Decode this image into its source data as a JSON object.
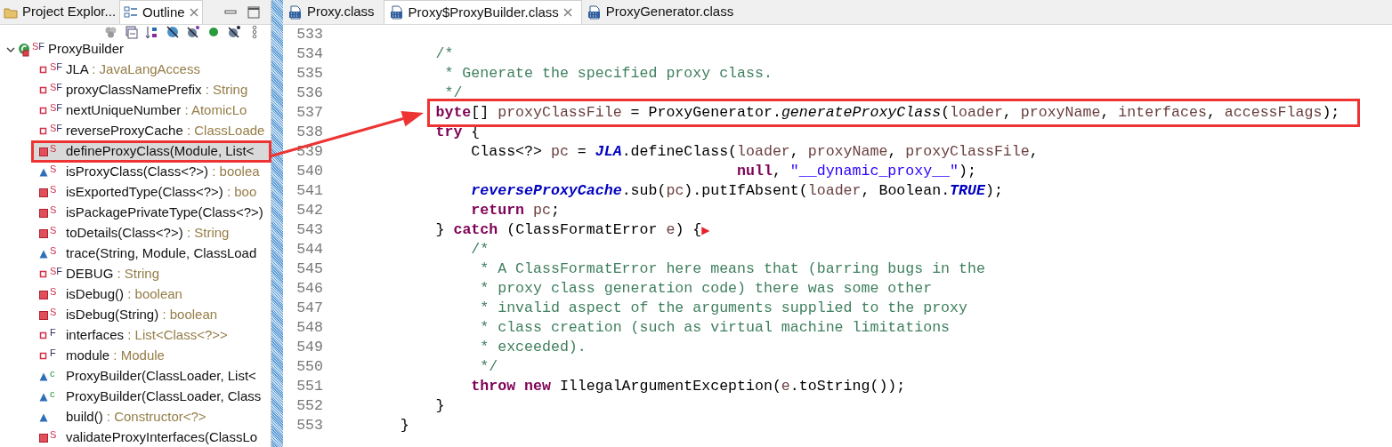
{
  "left_panel": {
    "tabs": [
      {
        "label": "Project Explor...",
        "selected": false,
        "closable": false
      },
      {
        "label": "Outline",
        "selected": true,
        "closable": true
      }
    ],
    "outline": {
      "root": {
        "name": "ProxyBuilder",
        "expanded": true,
        "modifiers": [
          {
            "kind": "static",
            "text": "S"
          },
          {
            "kind": "final",
            "text": "F"
          }
        ]
      },
      "items": [
        {
          "kind": "private-field",
          "modifiers": [
            {
              "kind": "static",
              "text": "S"
            },
            {
              "kind": "final",
              "text": "F"
            }
          ],
          "name": "JLA",
          "type": " : JavaLangAccess",
          "boxed": false
        },
        {
          "kind": "private-field",
          "modifiers": [
            {
              "kind": "static",
              "text": "S"
            },
            {
              "kind": "final",
              "text": "F"
            }
          ],
          "name": "proxyClassNamePrefix",
          "type": " : String",
          "boxed": false
        },
        {
          "kind": "private-field",
          "modifiers": [
            {
              "kind": "static",
              "text": "S"
            },
            {
              "kind": "final",
              "text": "F"
            }
          ],
          "name": "nextUniqueNumber",
          "type": " : AtomicLo",
          "boxed": false
        },
        {
          "kind": "private-field",
          "modifiers": [
            {
              "kind": "static",
              "text": "S"
            },
            {
              "kind": "final",
              "text": "F"
            }
          ],
          "name": "reverseProxyCache",
          "type": " : ClassLoade",
          "boxed": false
        },
        {
          "kind": "private-method",
          "modifiers": [
            {
              "kind": "static",
              "text": "S"
            }
          ],
          "name": "defineProxyClass(Module, List<",
          "boxed": true
        },
        {
          "kind": "package-method",
          "modifiers": [
            {
              "kind": "static",
              "text": "S"
            }
          ],
          "name": "isProxyClass(Class<?>)",
          "type": " : boolea",
          "boxed": false
        },
        {
          "kind": "private-method",
          "modifiers": [
            {
              "kind": "static",
              "text": "S"
            }
          ],
          "name": "isExportedType(Class<?>)",
          "type": " : boo",
          "boxed": false
        },
        {
          "kind": "private-method",
          "modifiers": [
            {
              "kind": "static",
              "text": "S"
            }
          ],
          "name": "isPackagePrivateType(Class<?>)",
          "boxed": false
        },
        {
          "kind": "private-method",
          "modifiers": [
            {
              "kind": "static",
              "text": "S"
            }
          ],
          "name": "toDetails(Class<?>)",
          "type": " : String",
          "boxed": false
        },
        {
          "kind": "package-method",
          "modifiers": [
            {
              "kind": "static",
              "text": "S"
            }
          ],
          "name": "trace(String, Module, ClassLoad",
          "boxed": false
        },
        {
          "kind": "private-field",
          "modifiers": [
            {
              "kind": "static",
              "text": "S"
            },
            {
              "kind": "final",
              "text": "F"
            }
          ],
          "name": "DEBUG",
          "type": " : String",
          "boxed": false
        },
        {
          "kind": "private-method",
          "modifiers": [
            {
              "kind": "static",
              "text": "S"
            }
          ],
          "name": "isDebug()",
          "type": " : boolean",
          "boxed": false
        },
        {
          "kind": "private-method",
          "modifiers": [
            {
              "kind": "static",
              "text": "S"
            }
          ],
          "name": "isDebug(String)",
          "type": " : boolean",
          "boxed": false
        },
        {
          "kind": "private-field",
          "modifiers": [
            {
              "kind": "final",
              "text": "F"
            }
          ],
          "name": "interfaces",
          "type": " : List<Class<?>>",
          "boxed": false
        },
        {
          "kind": "private-field",
          "modifiers": [
            {
              "kind": "final",
              "text": "F"
            }
          ],
          "name": "module",
          "type": " : Module",
          "boxed": false
        },
        {
          "kind": "package-method",
          "modifiers": [
            {
              "kind": "constructor",
              "text": "c"
            }
          ],
          "name": "ProxyBuilder(ClassLoader, List<",
          "boxed": false
        },
        {
          "kind": "package-method",
          "modifiers": [
            {
              "kind": "constructor",
              "text": "c"
            }
          ],
          "name": "ProxyBuilder(ClassLoader, Class",
          "boxed": false
        },
        {
          "kind": "package-method",
          "name": "build()",
          "type": " : Constructor<?>",
          "boxed": false
        },
        {
          "kind": "private-method",
          "modifiers": [
            {
              "kind": "static",
              "text": "S"
            }
          ],
          "name": "validateProxyInterfaces(ClassLo",
          "boxed": false
        }
      ]
    }
  },
  "editor": {
    "tabs": [
      {
        "label": "Proxy.class",
        "selected": false,
        "closable": false
      },
      {
        "label": "Proxy$ProxyBuilder.class",
        "selected": true,
        "closable": true
      },
      {
        "label": "ProxyGenerator.class",
        "selected": false,
        "closable": false
      }
    ],
    "lines": [
      {
        "number": "533",
        "boxed": false
      },
      {
        "number": "534",
        "boxed": false,
        "tokens": [
          {
            "kind": "comment",
            "text": "            /*"
          }
        ]
      },
      {
        "number": "535",
        "boxed": false,
        "tokens": [
          {
            "kind": "comment",
            "text": "             * Generate the specified proxy class."
          }
        ]
      },
      {
        "number": "536",
        "boxed": false,
        "tokens": [
          {
            "kind": "comment",
            "text": "             */"
          }
        ]
      },
      {
        "number": "537",
        "boxed": true,
        "tokens": [
          {
            "kind": "keyword",
            "text": "            byte"
          },
          {
            "kind": "plain",
            "text": "[] "
          },
          {
            "kind": "variable",
            "text": "proxyClassFile"
          },
          {
            "kind": "plain",
            "text": " = ProxyGenerator."
          },
          {
            "kind": "static_method",
            "text": "generateProxyClass"
          },
          {
            "kind": "plain",
            "text": "("
          },
          {
            "kind": "variable",
            "text": "loader"
          },
          {
            "kind": "plain",
            "text": ", "
          },
          {
            "kind": "variable",
            "text": "proxyName"
          },
          {
            "kind": "plain",
            "text": ", "
          },
          {
            "kind": "variable",
            "text": "interfaces"
          },
          {
            "kind": "plain",
            "text": ", "
          },
          {
            "kind": "variable",
            "text": "accessFlags"
          },
          {
            "kind": "plain",
            "text": ");"
          }
        ]
      },
      {
        "number": "538",
        "boxed": false,
        "tokens": [
          {
            "kind": "keyword",
            "text": "            try"
          },
          {
            "kind": "plain",
            "text": " {"
          }
        ]
      },
      {
        "number": "539",
        "boxed": false,
        "tokens": [
          {
            "kind": "plain",
            "text": "                Class<?> "
          },
          {
            "kind": "variable",
            "text": "pc"
          },
          {
            "kind": "plain",
            "text": " = "
          },
          {
            "kind": "static_field",
            "text": "JLA"
          },
          {
            "kind": "plain",
            "text": ".defineClass("
          },
          {
            "kind": "variable",
            "text": "loader"
          },
          {
            "kind": "plain",
            "text": ", "
          },
          {
            "kind": "variable",
            "text": "proxyName"
          },
          {
            "kind": "plain",
            "text": ", "
          },
          {
            "kind": "variable",
            "text": "proxyClassFile"
          },
          {
            "kind": "plain",
            "text": ","
          }
        ]
      },
      {
        "number": "540",
        "boxed": false,
        "tokens": [
          {
            "kind": "keyword",
            "text": "                                              null"
          },
          {
            "kind": "plain",
            "text": ", "
          },
          {
            "kind": "string",
            "text": "\"__dynamic_proxy__\""
          },
          {
            "kind": "plain",
            "text": ");"
          }
        ]
      },
      {
        "number": "541",
        "boxed": false,
        "tokens": [
          {
            "kind": "static_field",
            "text": "                reverseProxyCache"
          },
          {
            "kind": "plain",
            "text": ".sub("
          },
          {
            "kind": "variable",
            "text": "pc"
          },
          {
            "kind": "plain",
            "text": ").putIfAbsent("
          },
          {
            "kind": "variable",
            "text": "loader"
          },
          {
            "kind": "plain",
            "text": ", Boolean."
          },
          {
            "kind": "static_field",
            "text": "TRUE"
          },
          {
            "kind": "plain",
            "text": ");"
          }
        ]
      },
      {
        "number": "542",
        "boxed": false,
        "tokens": [
          {
            "kind": "keyword",
            "text": "                return "
          },
          {
            "kind": "variable",
            "text": "pc"
          },
          {
            "kind": "plain",
            "text": ";"
          }
        ]
      },
      {
        "number": "543",
        "boxed": false,
        "tokens": [
          {
            "kind": "plain",
            "text": "            } "
          },
          {
            "kind": "keyword",
            "text": "catch"
          },
          {
            "kind": "plain",
            "text": " (ClassFormatError "
          },
          {
            "kind": "variable",
            "text": "e"
          },
          {
            "kind": "plain",
            "text": ") {"
          },
          {
            "kind": "marker",
            "text": "▶"
          }
        ]
      },
      {
        "number": "544",
        "boxed": false,
        "tokens": [
          {
            "kind": "comment",
            "text": "                /*"
          }
        ]
      },
      {
        "number": "545",
        "boxed": false,
        "tokens": [
          {
            "kind": "comment",
            "text": "                 * A ClassFormatError here means that (barring bugs in the"
          }
        ]
      },
      {
        "number": "546",
        "boxed": false,
        "tokens": [
          {
            "kind": "comment",
            "text": "                 * proxy class generation code) there was some other"
          }
        ]
      },
      {
        "number": "547",
        "boxed": false,
        "tokens": [
          {
            "kind": "comment",
            "text": "                 * invalid aspect of the arguments supplied to the proxy"
          }
        ]
      },
      {
        "number": "548",
        "boxed": false,
        "tokens": [
          {
            "kind": "comment",
            "text": "                 * class creation (such as virtual machine limitations"
          }
        ]
      },
      {
        "number": "549",
        "boxed": false,
        "tokens": [
          {
            "kind": "comment",
            "text": "                 * exceeded)."
          }
        ]
      },
      {
        "number": "550",
        "boxed": false,
        "tokens": [
          {
            "kind": "comment",
            "text": "                 */"
          }
        ]
      },
      {
        "number": "551",
        "boxed": false,
        "tokens": [
          {
            "kind": "keyword",
            "text": "                throw new"
          },
          {
            "kind": "plain",
            "text": " IllegalArgumentException("
          },
          {
            "kind": "variable",
            "text": "e"
          },
          {
            "kind": "plain",
            "text": ".toString());"
          }
        ]
      },
      {
        "number": "552",
        "boxed": false,
        "tokens": [
          {
            "kind": "plain",
            "text": "            }"
          }
        ]
      },
      {
        "number": "553",
        "boxed": false,
        "tokens": [
          {
            "kind": "plain",
            "text": "        }"
          }
        ]
      }
    ]
  }
}
